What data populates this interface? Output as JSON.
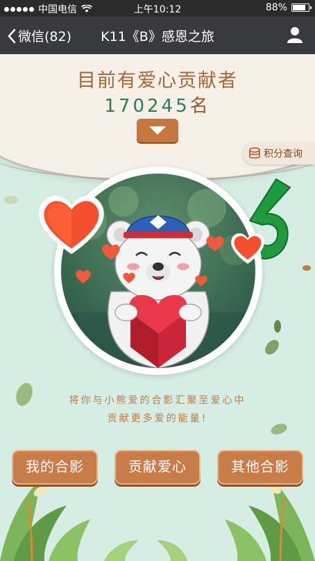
{
  "status_bar": {
    "carrier": "中国电信",
    "time": "上午10:12",
    "battery": "88%",
    "battery_level": 0.88
  },
  "nav": {
    "back_label": "微信(82)",
    "title": "K11《B》感恩之旅"
  },
  "header": {
    "title": "目前有爱心贡献者",
    "count": "170245",
    "count_unit": "名"
  },
  "points_button": {
    "label": "积分查询"
  },
  "caption": {
    "line1": "将你与小熊爱的合影汇聚至爱心中",
    "line2": "贡献更多爱的能量!"
  },
  "actions": {
    "my_photos": "我的合影",
    "donate_love": "贡献爱心",
    "other_photos": "其他合影"
  },
  "colors": {
    "nav_bg": "#393a3f",
    "accent_brown": "#c87c48",
    "count_green": "#2f7a56",
    "heart_red": "#e8384a"
  }
}
